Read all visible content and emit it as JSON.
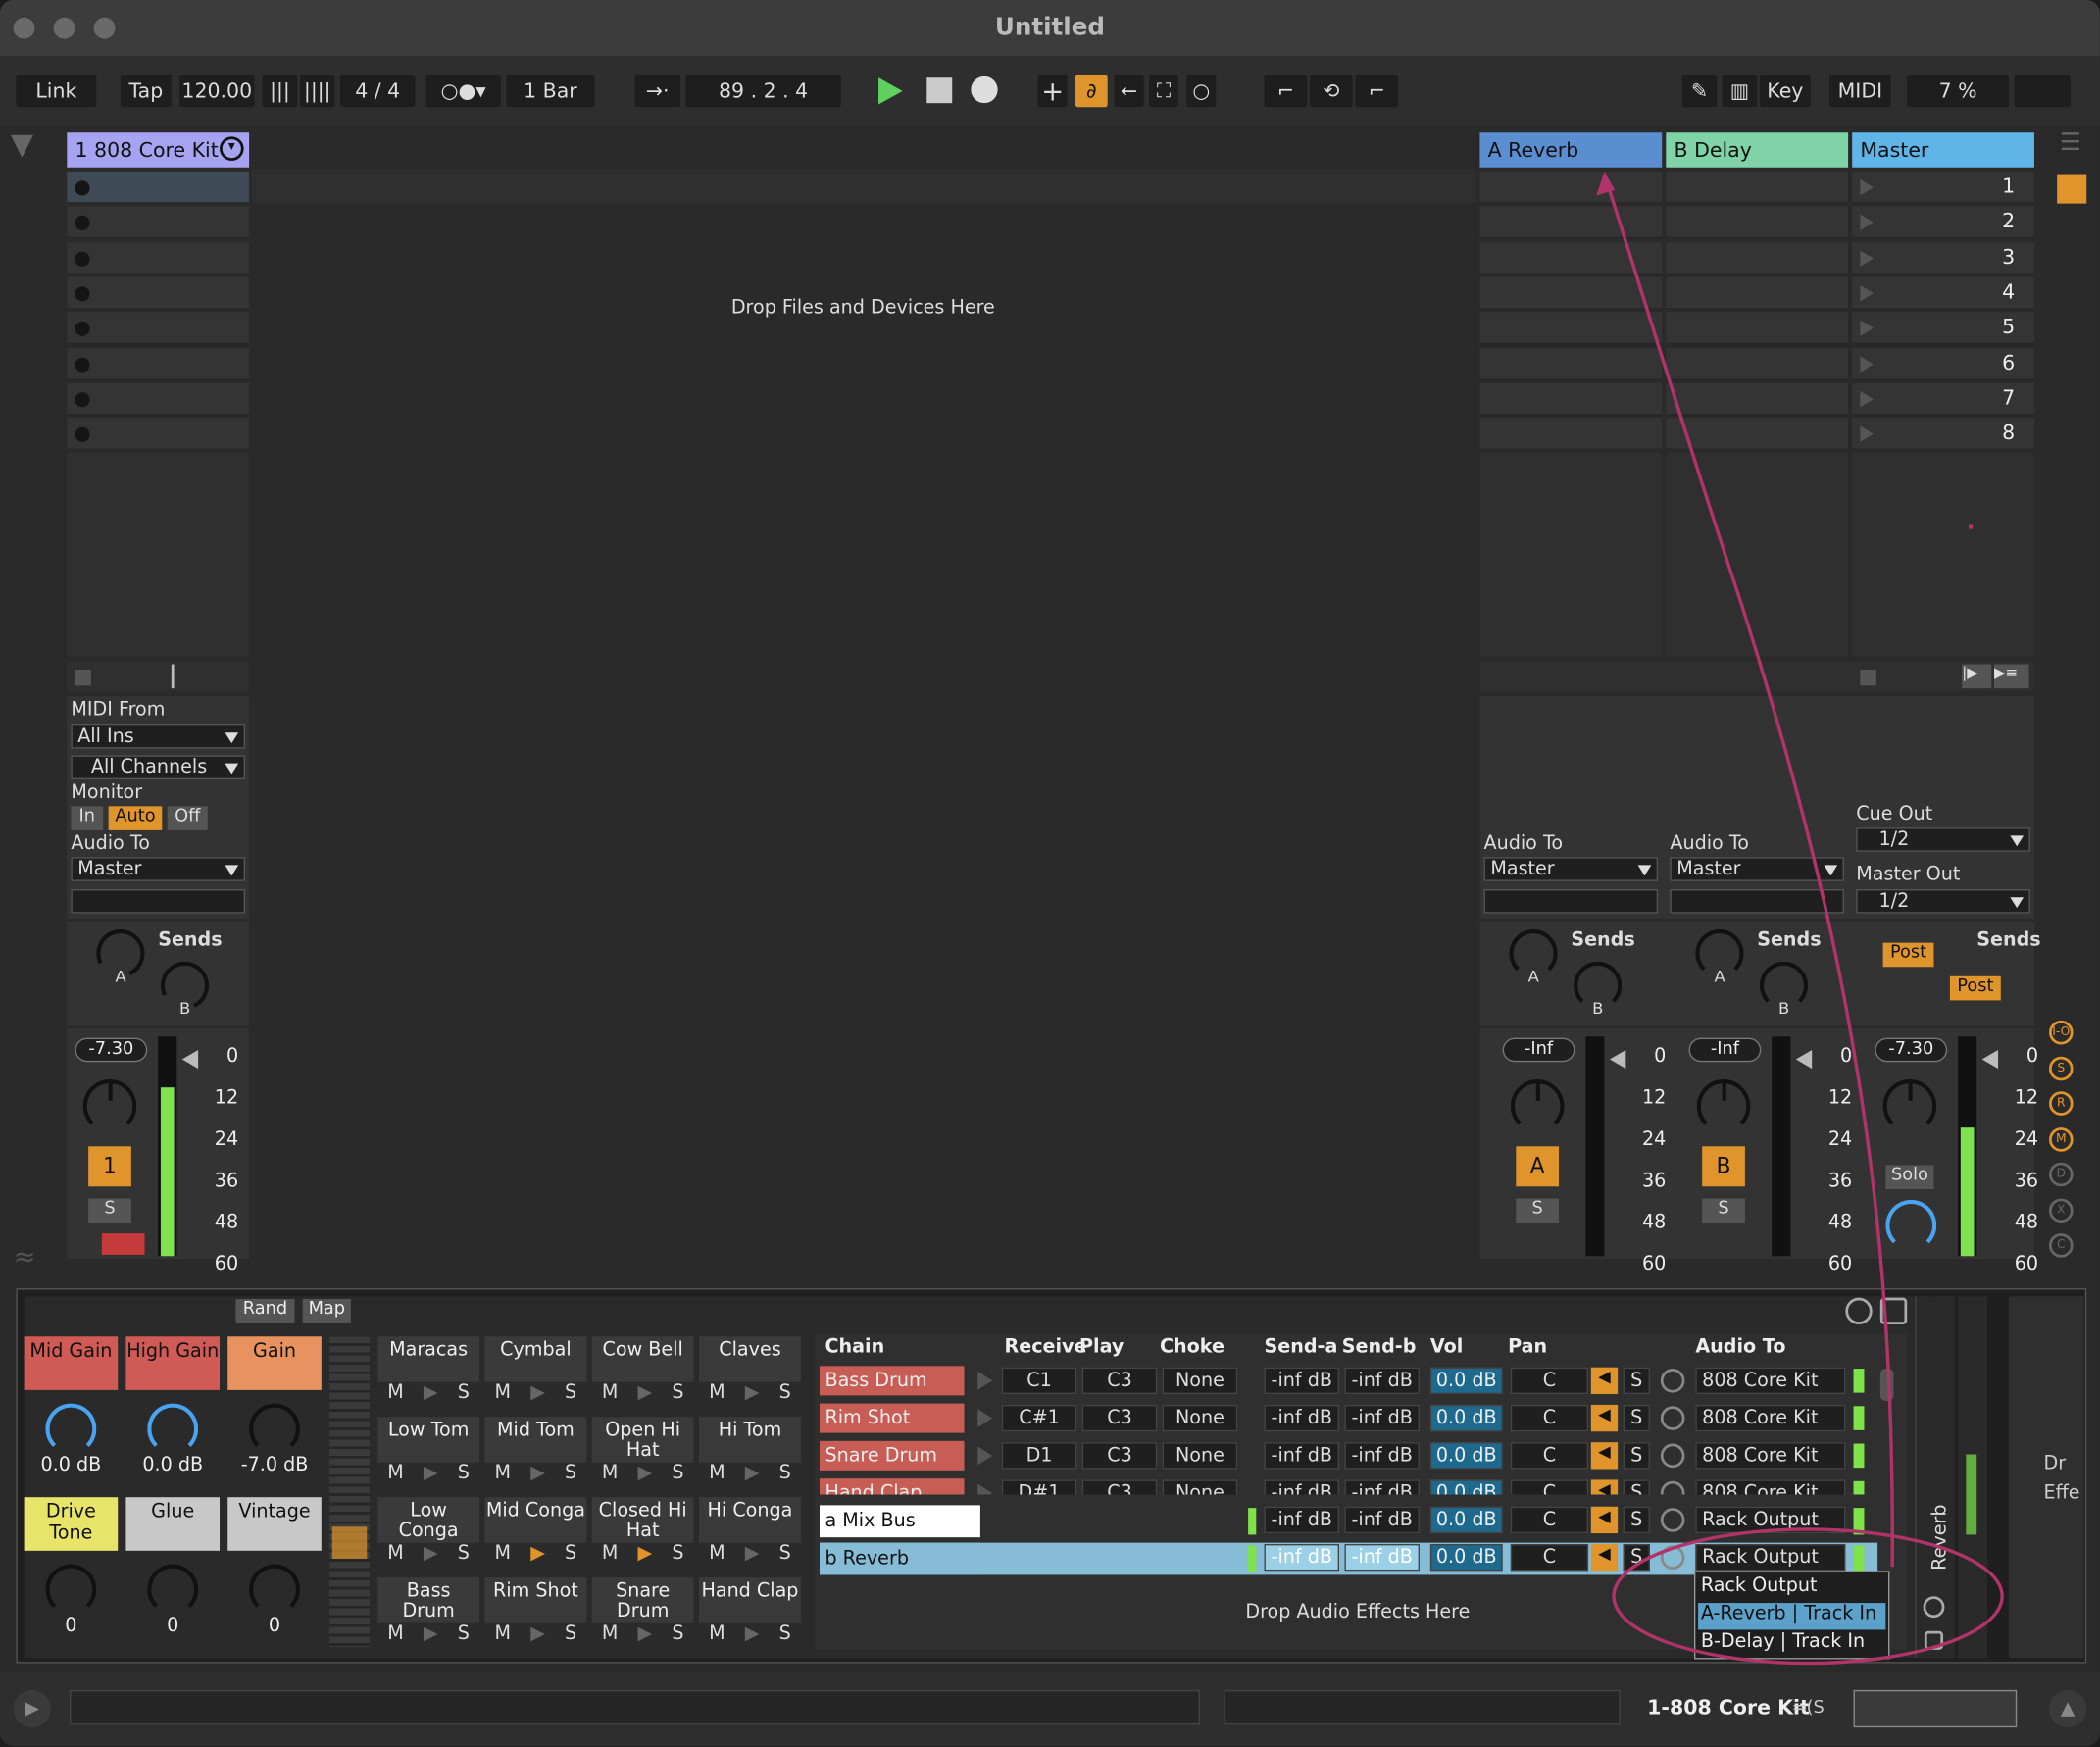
{
  "window": {
    "title": "Untitled"
  },
  "transport": {
    "link": "Link",
    "tap": "Tap",
    "tempo": "120.00",
    "signature": "4 / 4",
    "quantize": "1 Bar",
    "position": "89 .   2 .   4",
    "key": "Key",
    "midi": "MIDI",
    "cpu": "7 %"
  },
  "tracks": {
    "drum": "1 808 Core Kit",
    "a": "A Reverb",
    "b": "B Delay",
    "master": "Master"
  },
  "drop_hint": "Drop Files and Devices Here",
  "scenes": [
    "1",
    "2",
    "3",
    "4",
    "5",
    "6",
    "7",
    "8"
  ],
  "io": {
    "midi_from": "MIDI From",
    "all_ins": "All Ins",
    "all_channels": "All Channels",
    "monitor": "Monitor",
    "mon_in": "In",
    "mon_auto": "Auto",
    "mon_off": "Off",
    "audio_to": "Audio To",
    "master": "Master",
    "cue_out": "Cue Out",
    "cue_val": "1/2",
    "master_out": "Master Out",
    "master_val": "1/2",
    "sends": "Sends",
    "post": "Post"
  },
  "mixer": {
    "drum_vol": "-7.30",
    "a_vol": "-Inf",
    "b_vol": "-Inf",
    "master_vol": "-7.30",
    "drum_num": "1",
    "a_letter": "A",
    "b_letter": "B",
    "solo": "S",
    "solo_label": "Solo",
    "ticks": [
      "0",
      "12",
      "24",
      "36",
      "48",
      "60"
    ],
    "knob_a": "A",
    "knob_b": "B"
  },
  "device": {
    "rand": "Rand",
    "map": "Map",
    "macros": [
      {
        "name": "Mid Gain",
        "value": "0.0 dB",
        "color": "#d05a55"
      },
      {
        "name": "High Gain",
        "value": "0.0 dB",
        "color": "#d05a55"
      },
      {
        "name": "Gain",
        "value": "-7.0 dB",
        "color": "#e8935f"
      },
      {
        "name": "Drive Tone",
        "value": "0",
        "color": "#e8e46a"
      },
      {
        "name": "Glue",
        "value": "0",
        "color": "#c8c8c8"
      },
      {
        "name": "Vintage",
        "value": "0",
        "color": "#c8c8c8"
      }
    ],
    "pads": [
      "Maracas",
      "Cymbal",
      "Cow Bell",
      "Claves",
      "Low Tom",
      "Mid Tom",
      "Open Hi Hat",
      "Hi Tom",
      "Low Conga",
      "Mid Conga",
      "Closed Hi Hat",
      "Hi Conga",
      "Bass Drum",
      "Rim Shot",
      "Snare Drum",
      "Hand Clap"
    ],
    "pad_ms": {
      "m": "M",
      "s": "S"
    },
    "chain_headers": {
      "chain": "Chain",
      "receive": "Receive",
      "play": "Play",
      "choke": "Choke",
      "send_a": "Send-a",
      "send_b": "Send-b",
      "vol": "Vol",
      "pan": "Pan",
      "audio_to": "Audio To"
    },
    "chains": [
      {
        "name": "Bass Drum",
        "receive": "C1",
        "play": "C3",
        "choke": "None",
        "sa": "-inf dB",
        "sb": "-inf dB",
        "vol": "0.0 dB",
        "pan": "C",
        "out": "808 Core Kit"
      },
      {
        "name": "Rim Shot",
        "receive": "C#1",
        "play": "C3",
        "choke": "None",
        "sa": "-inf dB",
        "sb": "-inf dB",
        "vol": "0.0 dB",
        "pan": "C",
        "out": "808 Core Kit"
      },
      {
        "name": "Snare Drum",
        "receive": "D1",
        "play": "C3",
        "choke": "None",
        "sa": "-inf dB",
        "sb": "-inf dB",
        "vol": "0.0 dB",
        "pan": "C",
        "out": "808 Core Kit"
      },
      {
        "name": "Hand Clap",
        "receive": "D#1",
        "play": "C3",
        "choke": "None",
        "sa": "-inf dB",
        "sb": "-inf dB",
        "vol": "0.0 dB",
        "pan": "C",
        "out": "808 Core Kit"
      }
    ],
    "returns": [
      {
        "name": "a Mix Bus",
        "sa": "-inf dB",
        "sb": "-inf dB",
        "vol": "0.0 dB",
        "pan": "C",
        "out": "Rack Output"
      },
      {
        "name": "b Reverb",
        "sa": "-inf dB",
        "sb": "-inf dB",
        "vol": "0.0 dB",
        "pan": "C",
        "out": "Rack Output"
      }
    ],
    "menu": [
      "Rack Output",
      "A-Reverb | Track In",
      "B-Delay | Track In"
    ],
    "drop_fx": "Drop Audio Effects Here",
    "side_label": "Reverb",
    "right_label": "Dr Effe"
  },
  "status": {
    "track": "1-808 Core Kit",
    "extra": "=(S"
  },
  "side_letters": [
    "I-O",
    "S",
    "R",
    "M",
    "D",
    "X",
    "C"
  ]
}
